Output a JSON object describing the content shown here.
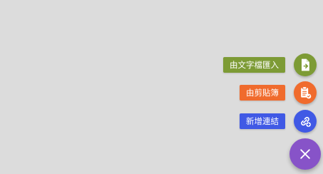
{
  "colors": {
    "background": "#dcdcdc",
    "import_accent": "#7d9b35",
    "clipboard_accent": "#f06b2d",
    "link_accent": "#4059e5",
    "main_fab": "#8753c8"
  },
  "fab_menu": {
    "items": [
      {
        "label": "由文字檔匯入",
        "icon": "file-import-icon",
        "color": "#7d9b35"
      },
      {
        "label": "由剪貼簿",
        "icon": "clipboard-check-icon",
        "color": "#f06b2d"
      },
      {
        "label": "新增連結",
        "icon": "link-add-icon",
        "color": "#4059e5"
      }
    ],
    "main_button": {
      "icon": "close-icon",
      "color": "#8753c8"
    }
  }
}
